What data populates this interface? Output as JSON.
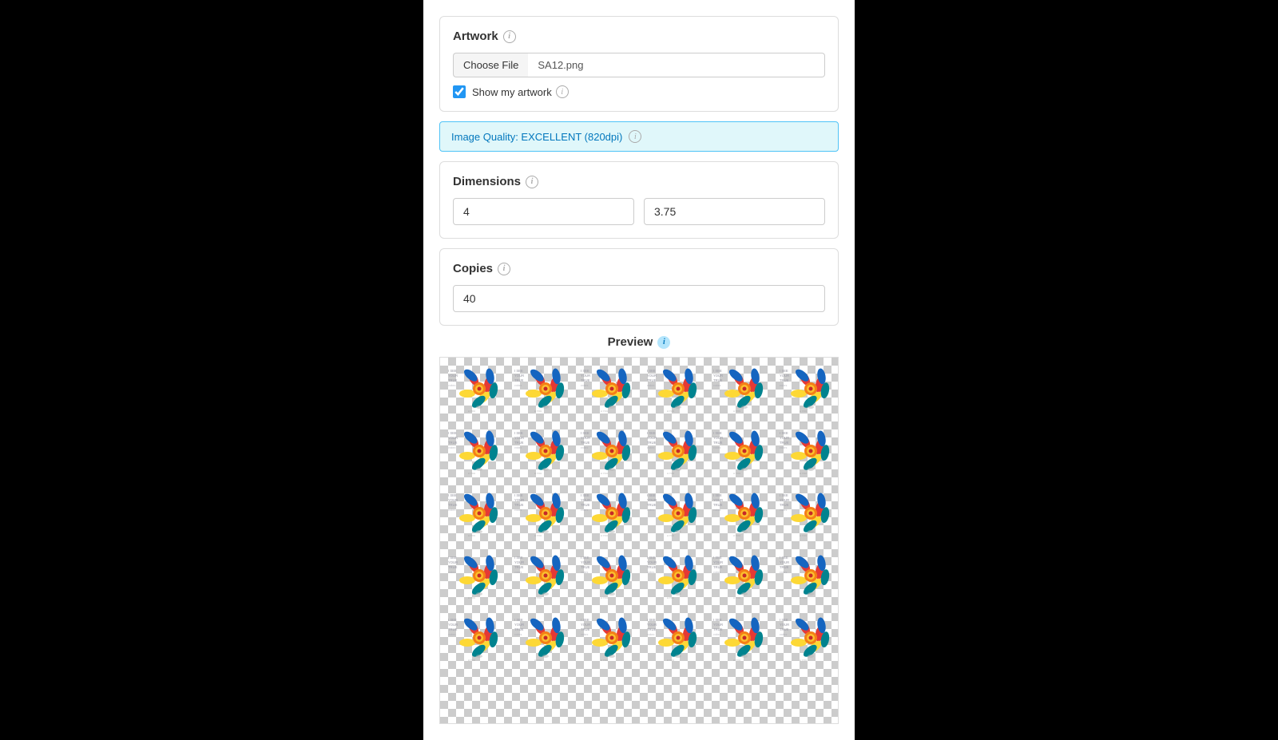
{
  "artwork": {
    "label": "Artwork",
    "choose_file_label": "Choose File",
    "file_name": "SA12.png",
    "show_artwork_label": "Show my artwork",
    "checkbox_checked": true
  },
  "quality": {
    "label": "Image Quality: EXCELLENT (820dpi)"
  },
  "dimensions": {
    "label": "Dimensions",
    "width_value": "4",
    "height_value": "3.75"
  },
  "copies": {
    "label": "Copies",
    "value": "40"
  },
  "preview": {
    "label": "Preview",
    "sticker_text_line1": "I SEE",
    "sticker_text_line2": "YOUR",
    "sticker_text_line3": "TRUE",
    "sticker_text_line4": "colors"
  },
  "icons": {
    "info": "i",
    "preview_info": "i"
  }
}
